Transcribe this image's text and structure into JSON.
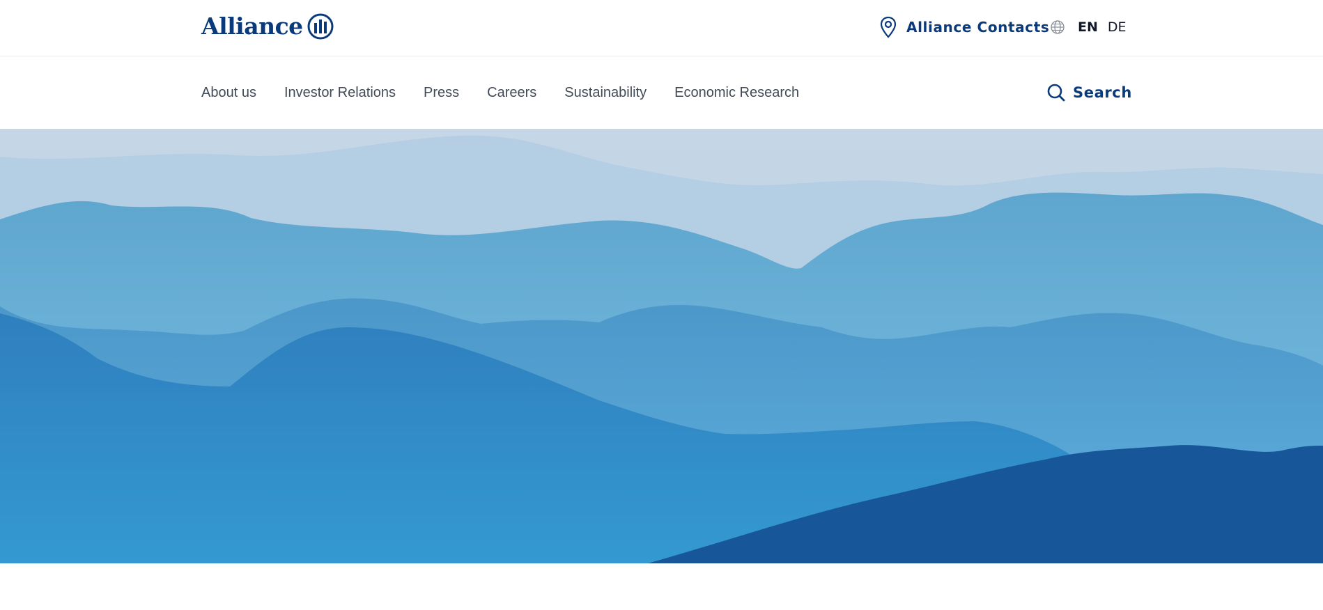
{
  "header": {
    "brand": "Alliance",
    "logo_icon": "alliance-pillars-logo",
    "contacts_label": "Alliance Contacts",
    "contacts_icon": "map-pin-icon",
    "language_icon": "globe-icon",
    "languages": [
      "EN",
      "DE"
    ],
    "active_language": "EN"
  },
  "nav": {
    "items": [
      "About us",
      "Investor Relations",
      "Press",
      "Careers",
      "Sustainability",
      "Economic Research"
    ],
    "search_label": "Search",
    "search_icon": "search-icon"
  },
  "hero": {
    "image": "misty-blue-mountain-ridges"
  },
  "colors": {
    "brand_blue": "#0a3a7a",
    "nav_text": "#414a57",
    "divider": "#e8eaee"
  }
}
